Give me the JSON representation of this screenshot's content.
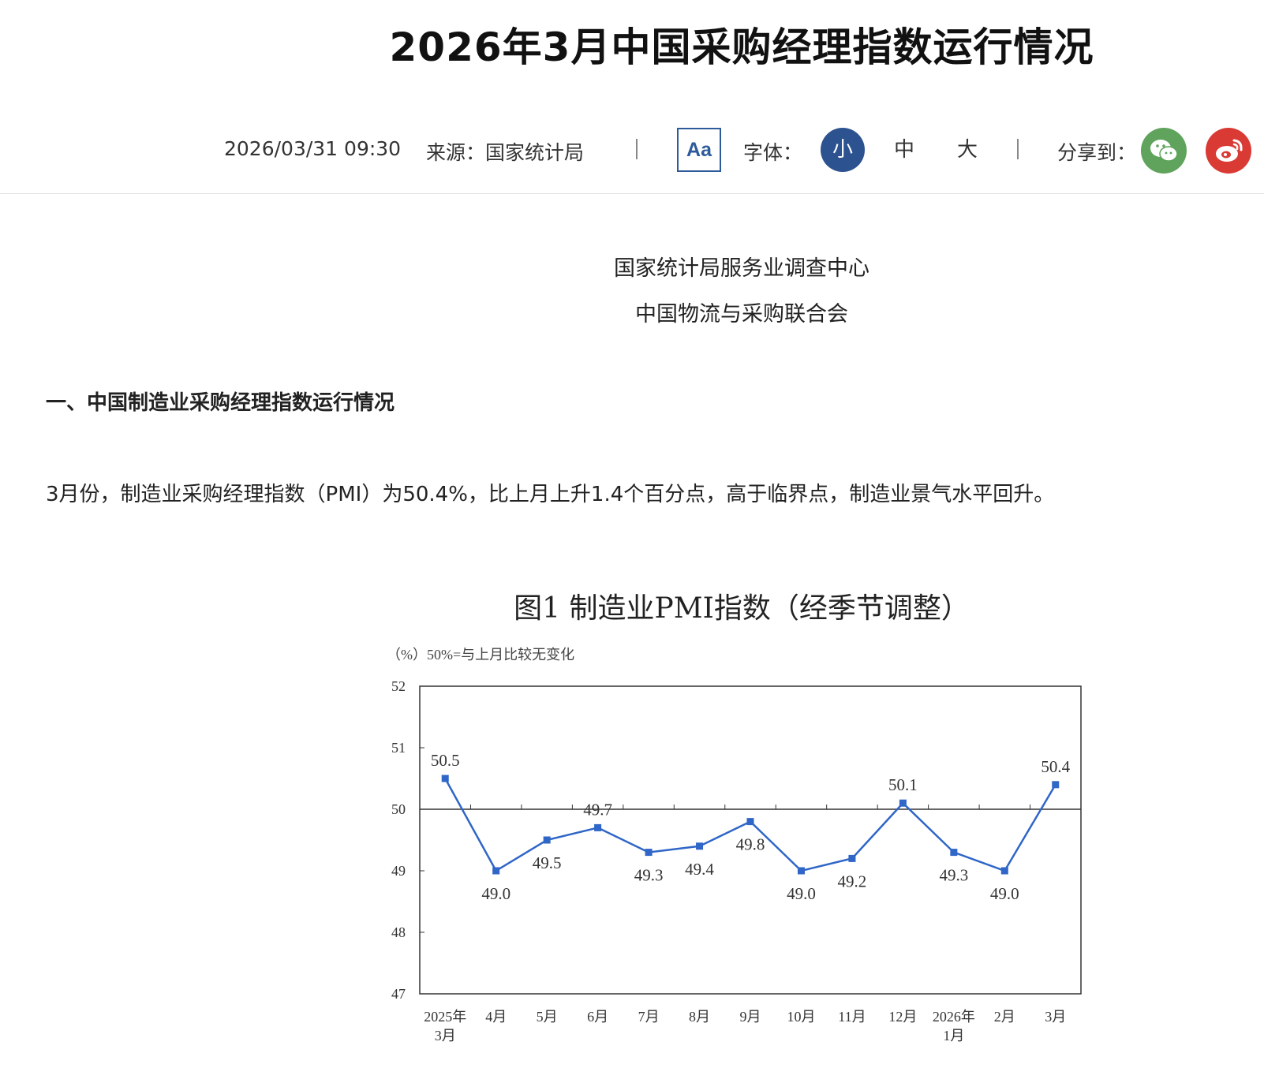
{
  "article": {
    "title": "2026年3月中国采购经理指数运行情况",
    "datetime": "2026/03/31 09:30",
    "source": "来源：国家统计局",
    "font_label": "字体：",
    "font_small": "小",
    "font_medium": "中",
    "font_large": "大",
    "aa_label": "Aa",
    "share_label": "分享到：",
    "org1": "国家统计局服务业调查中心",
    "org2": "中国物流与采购联合会",
    "section1": "一、中国制造业采购经理指数运行情况",
    "para1": "3月份，制造业采购经理指数（PMI）为50.4%，比上月上升1.4个百分点，高于临界点，制造业景气水平回升。"
  },
  "icons": {
    "wechat": "wechat-icon",
    "weibo": "weibo-icon"
  },
  "colors": {
    "accent": "#2c5290",
    "wechat": "#5fa35c",
    "weibo": "#d93a34",
    "series": "#2f66c7"
  },
  "chart_data": {
    "type": "line",
    "title": "图1  制造业PMI指数（经季节调整）",
    "ylabel": "（%）50%=与上月比较无变化",
    "ylim": [
      47,
      52
    ],
    "yticks": [
      "47",
      "48",
      "49",
      "50",
      "51",
      "52"
    ],
    "reference_line": 50,
    "categories": [
      [
        "2025年",
        "3月"
      ],
      [
        "4月"
      ],
      [
        "5月"
      ],
      [
        "6月"
      ],
      [
        "7月"
      ],
      [
        "8月"
      ],
      [
        "9月"
      ],
      [
        "10月"
      ],
      [
        "11月"
      ],
      [
        "12月"
      ],
      [
        "2026年",
        "1月"
      ],
      [
        "2月"
      ],
      [
        "3月"
      ]
    ],
    "values": [
      50.5,
      49.0,
      49.5,
      49.7,
      49.3,
      49.4,
      49.8,
      49.0,
      49.2,
      50.1,
      49.3,
      49.0,
      50.4
    ],
    "value_labels": [
      "50.5",
      "49.0",
      "49.5",
      "49.7",
      "49.3",
      "49.4",
      "49.8",
      "49.0",
      "49.2",
      "50.1",
      "49.3",
      "49.0",
      "50.4"
    ],
    "label_positions": [
      "above",
      "below",
      "below",
      "above",
      "below",
      "below",
      "below",
      "below",
      "below",
      "above",
      "below",
      "below",
      "above"
    ],
    "grid": false,
    "legend": "none"
  }
}
